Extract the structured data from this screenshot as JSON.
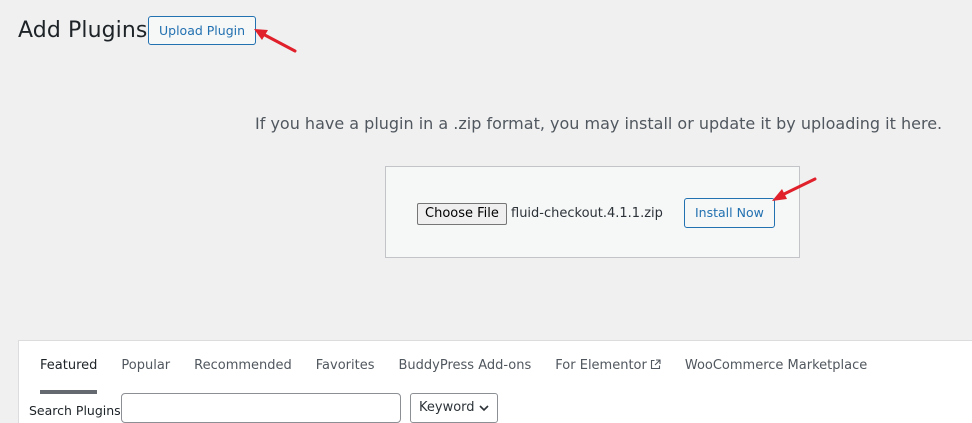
{
  "header": {
    "title": "Add Plugins",
    "upload_button": "Upload Plugin"
  },
  "upload": {
    "help_text": "If you have a plugin in a .zip format, you may install or update it by uploading it here.",
    "choose_file_label": "Choose File",
    "file_name": "fluid-checkout.4.1.1.zip",
    "install_button": "Install Now"
  },
  "filter": {
    "tabs": [
      {
        "label": "Featured",
        "current": true
      },
      {
        "label": "Popular"
      },
      {
        "label": "Recommended"
      },
      {
        "label": "Favorites"
      },
      {
        "label": "BuddyPress Add-ons"
      },
      {
        "label": "For Elementor",
        "icon": "external-link-icon"
      },
      {
        "label": "WooCommerce Marketplace"
      }
    ],
    "search_label": "Search Plugins",
    "search_value": "",
    "search_type": "Keyword"
  },
  "colors": {
    "accent": "#2271b1",
    "annotation_arrow": "#e0202a",
    "background": "#f0f0f1"
  }
}
